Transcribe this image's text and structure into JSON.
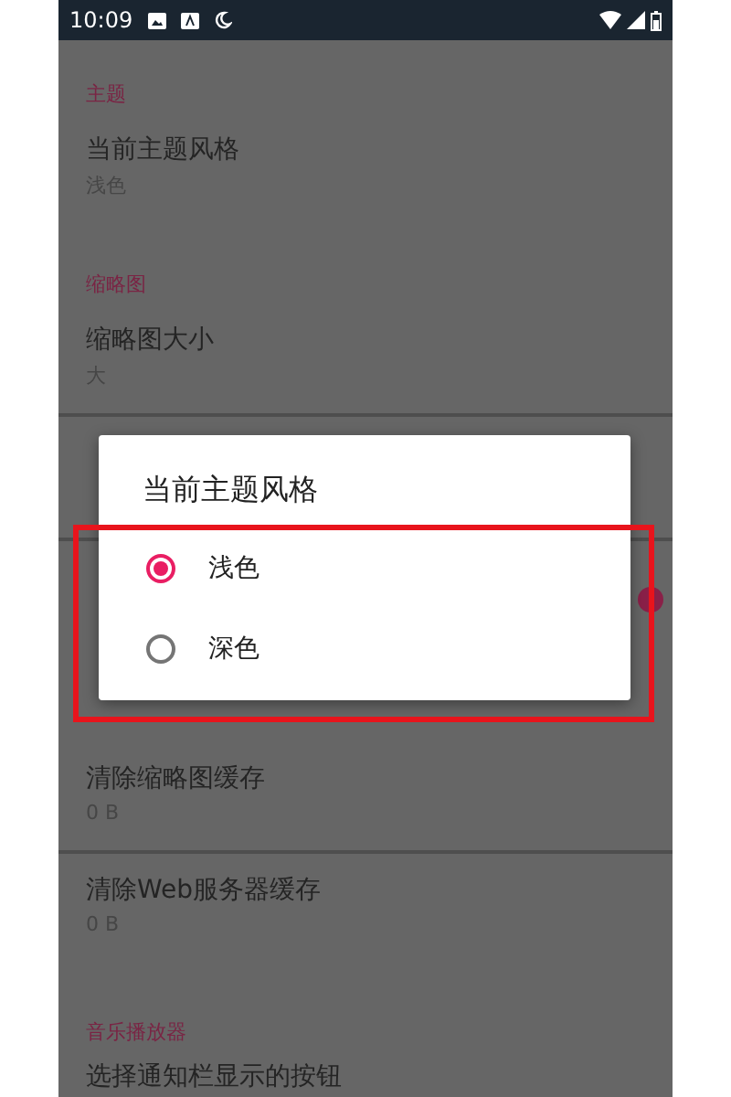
{
  "status_bar": {
    "time": "10:09"
  },
  "settings": [
    {
      "kind": "header",
      "title": "主题"
    },
    {
      "kind": "item",
      "title": "当前主题风格",
      "subtitle": "浅色"
    },
    {
      "kind": "header",
      "title": "缩略图"
    },
    {
      "kind": "item",
      "title": "缩略图大小",
      "subtitle": "大",
      "divider": true
    },
    {
      "kind": "item",
      "divider": true
    },
    {
      "kind": "switch",
      "on": true
    },
    {
      "kind": "gap"
    },
    {
      "kind": "item",
      "title": "清除缩略图缓存",
      "subtitle": "0 B",
      "divider": true
    },
    {
      "kind": "item",
      "title": "清除Web服务器缓存",
      "subtitle": "0 B"
    },
    {
      "kind": "header",
      "title": "音乐播放器"
    },
    {
      "kind": "item",
      "title": "选择通知栏显示的按钮"
    }
  ],
  "dialog": {
    "title": "当前主题风格",
    "options": [
      {
        "label": "浅色",
        "selected": true
      },
      {
        "label": "深色",
        "selected": false
      }
    ]
  }
}
